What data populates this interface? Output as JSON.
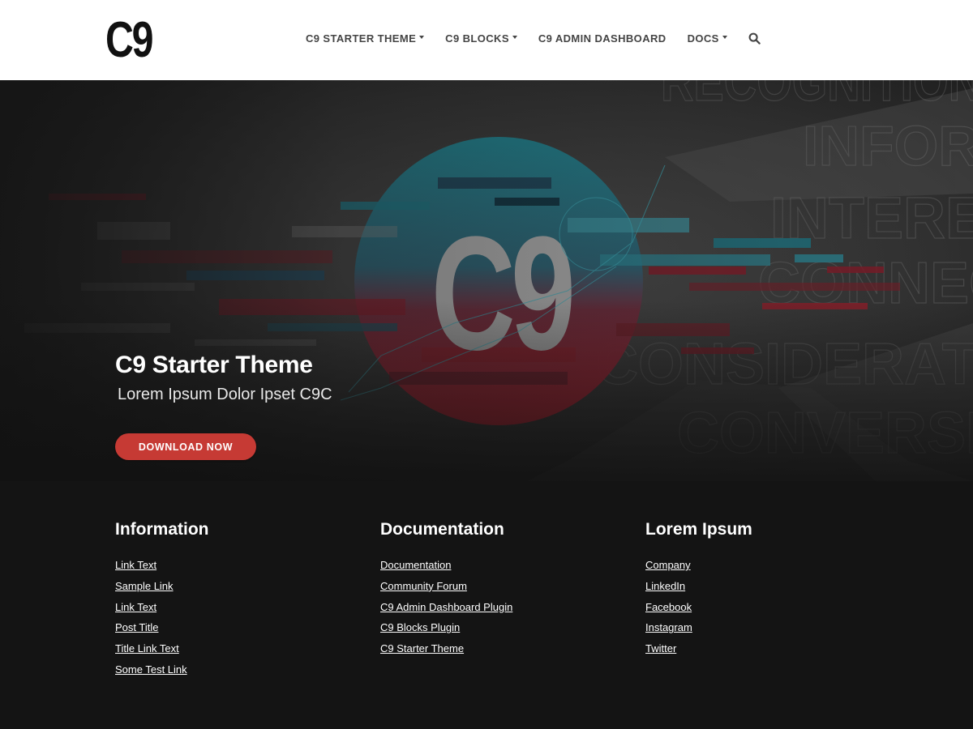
{
  "header": {
    "logo_text": "C9",
    "nav": [
      {
        "label": "C9 STARTER THEME",
        "dropdown": true
      },
      {
        "label": "C9 BLOCKS",
        "dropdown": true
      },
      {
        "label": "C9 ADMIN DASHBOARD",
        "dropdown": false
      },
      {
        "label": "DOCS",
        "dropdown": true
      }
    ],
    "search_icon": "search-icon"
  },
  "hero": {
    "graphic_logo_text": "C9",
    "title": "C9 Starter Theme",
    "subtitle": "Lorem Ipsum Dolor Ipset C9C",
    "button_label": "DOWNLOAD NOW",
    "colors": {
      "accent": "#c63a34",
      "teal": "#1f7f8c",
      "red": "#b51f2e",
      "overlay": "#262626"
    }
  },
  "footer": {
    "columns": [
      {
        "heading": "Information",
        "links": [
          "Link Text",
          "Sample Link",
          "Link Text",
          "Post Title",
          "Title Link Text",
          "Some Test Link"
        ]
      },
      {
        "heading": "Documentation",
        "links": [
          "Documentation",
          "Community Forum",
          "C9 Admin Dashboard Plugin",
          "C9 Blocks Plugin",
          "C9 Starter Theme"
        ]
      },
      {
        "heading": "Lorem Ipsum",
        "links": [
          "Company",
          "LinkedIn",
          "Facebook",
          "Instagram",
          "Twitter"
        ]
      }
    ]
  }
}
